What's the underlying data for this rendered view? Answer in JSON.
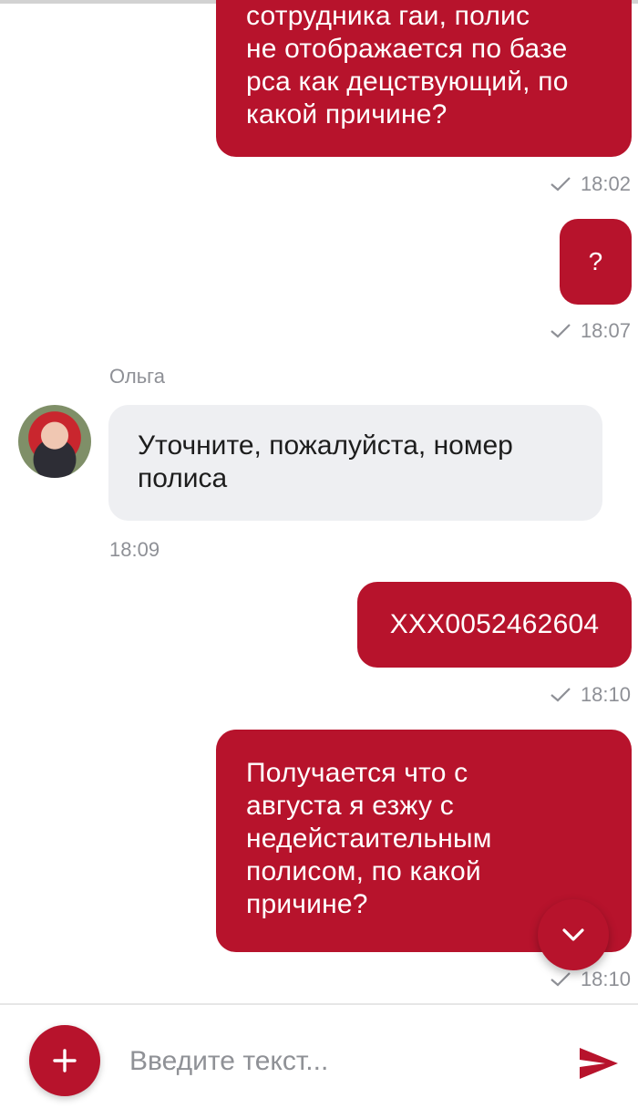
{
  "messages": [
    {
      "direction": "outgoing",
      "lines": [
        "сотрудника гаи, полис",
        "не отображается по базе",
        "рса как децствующий, по",
        "какой причине?"
      ],
      "time": "18:02"
    },
    {
      "direction": "outgoing",
      "lines": [
        "?"
      ],
      "time": "18:07"
    },
    {
      "direction": "incoming",
      "sender": "Ольга",
      "lines": [
        "Уточните, пожалуйста, номер",
        "полиса"
      ],
      "time": "18:09"
    },
    {
      "direction": "outgoing",
      "lines": [
        "XXX0052462604"
      ],
      "time": "18:10"
    },
    {
      "direction": "outgoing",
      "lines": [
        "Получается что с",
        "августа я езжу с",
        "недейстаительным",
        "полисом, по какой",
        "причине?"
      ],
      "time": "18:10"
    }
  ],
  "composer": {
    "placeholder": "Введите текст..."
  },
  "icons": {
    "read_receipt": "check-icon",
    "scroll_down": "chevron-down-icon",
    "add": "plus-icon",
    "send": "send-icon"
  },
  "colors": {
    "accent": "#b7132c",
    "incoming_bubble": "#eeeff2",
    "meta_text": "#8e9096"
  }
}
